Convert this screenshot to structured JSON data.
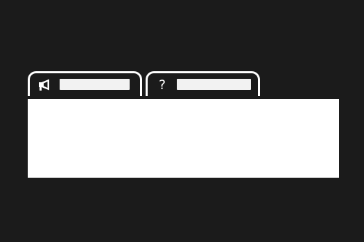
{
  "tabs": [
    {
      "icon": "megaphone-icon",
      "label": ""
    },
    {
      "icon": "question-mark-icon",
      "glyph": "?",
      "label": ""
    }
  ],
  "colors": {
    "background": "#1b1b1b",
    "foreground": "#ffffff"
  }
}
